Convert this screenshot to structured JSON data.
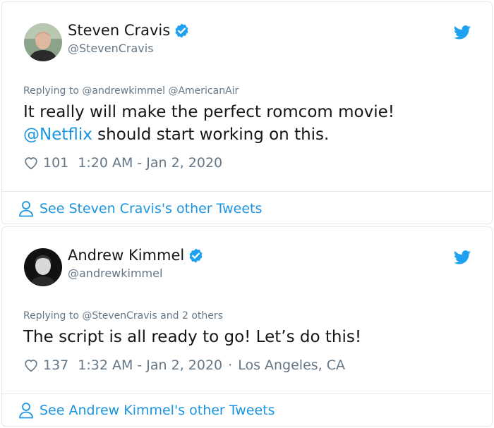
{
  "colors": {
    "link": "#1b95e0",
    "text_primary": "#14171a",
    "text_secondary": "#657786",
    "verified": "#1da1f2",
    "border": "#e1e8ed"
  },
  "tweets": [
    {
      "author_name": "Steven Cravis",
      "handle": "@StevenCravis",
      "verified_icon": "verified-badge-icon",
      "platform_icon": "twitter-bird-icon",
      "replying_to": "Replying to @andrewkimmel @AmericanAir",
      "text_line1": "It really will make the perfect romcom movie!",
      "mention": "@Netflix",
      "text_line2_rest": " should start working on this.",
      "likes": "101",
      "like_icon": "heart-icon",
      "time": "1:20 AM - Jan 2, 2020",
      "see_more": "See Steven Cravis's other Tweets",
      "see_more_icon": "person-icon"
    },
    {
      "author_name": "Andrew Kimmel",
      "handle": "@andrewkimmel",
      "verified_icon": "verified-badge-icon",
      "platform_icon": "twitter-bird-icon",
      "replying_to": "Replying to @StevenCravis and 2 others",
      "text_line1": "The script is all ready to go! Let’s do this!",
      "likes": "137",
      "like_icon": "heart-icon",
      "time": "1:32 AM - Jan 2, 2020",
      "separator": "·",
      "location": "Los Angeles, CA",
      "see_more": "See Andrew Kimmel's other Tweets",
      "see_more_icon": "person-icon"
    }
  ]
}
